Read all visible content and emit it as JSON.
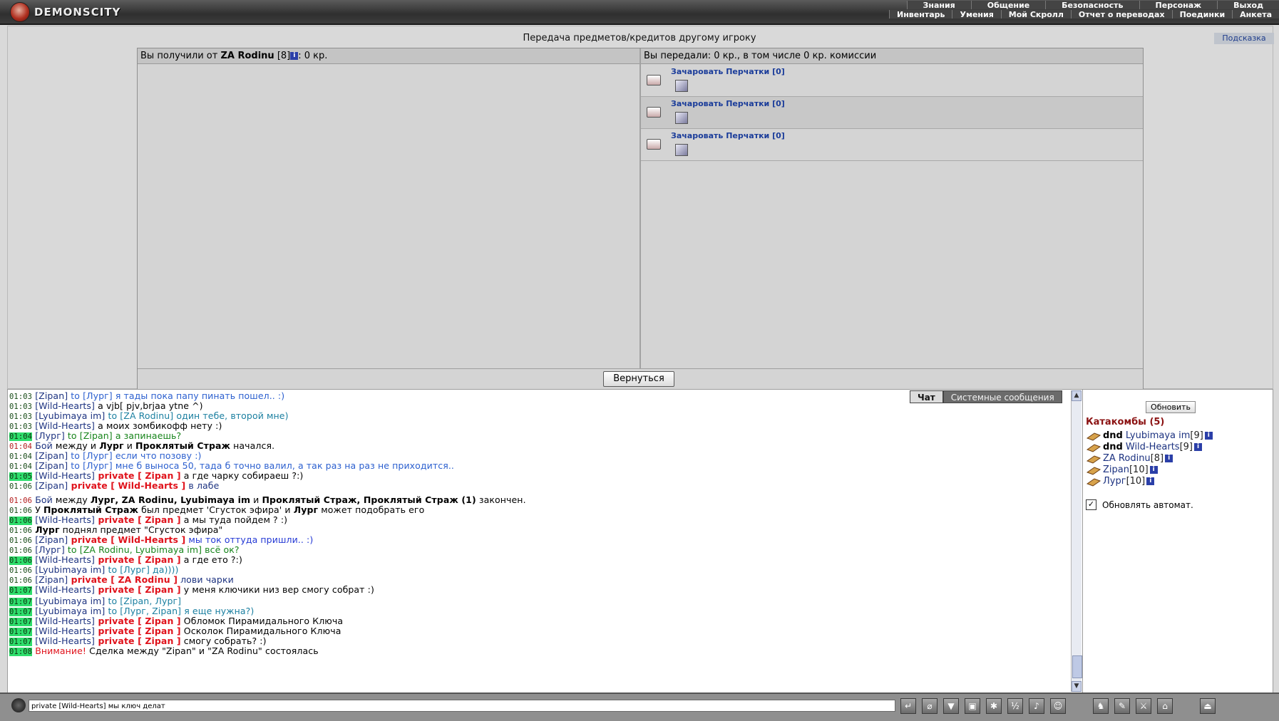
{
  "header": {
    "logo_text": "DEMONSCITY",
    "menu_top": [
      "Знания",
      "Общение",
      "Безопасность",
      "Персонаж",
      "Выход"
    ],
    "menu_bottom": [
      "Инвентарь",
      "Умения",
      "Мой Скролл",
      "Отчет о переводах",
      "Поединки",
      "Анкета"
    ]
  },
  "page": {
    "title": "Передача предметов/кредитов другому игроку",
    "hint_label": "Подсказка"
  },
  "transfer": {
    "received_prefix": "Вы получили от ",
    "received_player": "ZA Rodinu",
    "received_level": "[8]",
    "received_amount": ": 0 кр.",
    "given_text": "Вы передали: 0 кр., в том числе 0 кр. комиссии",
    "items": [
      {
        "name": "Зачаровать Перчатки [0]"
      },
      {
        "name": "Зачаровать Перчатки [0]"
      },
      {
        "name": "Зачаровать Перчатки [0]"
      }
    ],
    "back_label": "Вернуться"
  },
  "chat_tabs": {
    "chat": "Чат",
    "system": "Системные сообщения"
  },
  "chat": [
    {
      "time": "01:03",
      "tsClass": "g",
      "parts": [
        [
          "nm",
          "[Zipan]"
        ],
        [
          "to",
          " to [Лург] я тады пока папу пинать пошел.. :)"
        ]
      ]
    },
    {
      "time": "01:03",
      "tsClass": "g",
      "parts": [
        [
          "nm",
          "[Wild-Hearts]"
        ],
        [
          "sys",
          " а vjb[ pjv,brjaa ytne ^)"
        ]
      ]
    },
    {
      "time": "01:03",
      "tsClass": "g",
      "parts": [
        [
          "nm",
          "[Lyubimaya im]"
        ],
        [
          "tealmsg",
          " to [ZA Rodinu] один тебе, второй мне)"
        ]
      ]
    },
    {
      "time": "01:03",
      "tsClass": "g",
      "parts": [
        [
          "nm",
          "[Wild-Hearts]"
        ],
        [
          "sys",
          " а моих зомбикофф нету :)"
        ]
      ]
    },
    {
      "time": "01:04",
      "tsClass": "hl",
      "parts": [
        [
          "nm",
          "[Лург]"
        ],
        [
          "greenmsg",
          " to [Zipan] а запинаешь?"
        ]
      ]
    },
    {
      "time": "01:04",
      "tsClass": "r",
      "parts": [
        [
          "nm",
          "Бой"
        ],
        [
          "sys",
          " между и "
        ],
        [
          "b",
          "Лург"
        ],
        [
          "sys",
          " и "
        ],
        [
          "b",
          "Проклятый Страж"
        ],
        [
          "sys",
          " начался."
        ]
      ]
    },
    {
      "time": "01:04",
      "tsClass": "g",
      "parts": [
        [
          "nm",
          "[Zipan]"
        ],
        [
          "to",
          " to [Лург] если что позову :)"
        ]
      ]
    },
    {
      "time": "01:04",
      "tsClass": "g",
      "parts": [
        [
          "nm",
          "[Zipan]"
        ],
        [
          "to",
          " to [Лург] мне б выноса 50, тада б точно валил, а так раз на раз не приходится.."
        ]
      ]
    },
    {
      "time": "01:05",
      "tsClass": "hl",
      "parts": [
        [
          "nm",
          "[Wild-Hearts]"
        ],
        [
          "priv",
          " private [ Zipan ]"
        ],
        [
          "sys",
          " а где чарку собираеш ?:)"
        ]
      ]
    },
    {
      "time": "01:06",
      "tsClass": "g",
      "parts": [
        [
          "nm",
          "[Zipan]"
        ],
        [
          "priv",
          " private [ Wild-Hearts ]"
        ],
        [
          "nm",
          " в лабе"
        ]
      ]
    },
    {
      "time": "01:06",
      "tsClass": "r",
      "parts": [
        [
          "nm",
          "Бой"
        ],
        [
          "sys",
          " между "
        ],
        [
          "b",
          "Лург, ZA Rodinu, Lyubimaya im"
        ],
        [
          "sys",
          " и "
        ],
        [
          "b",
          "Проклятый Страж, Проклятый Страж (1)"
        ],
        [
          "sys",
          " закончен."
        ]
      ]
    },
    {
      "time": "01:06",
      "tsClass": "g",
      "parts": [
        [
          "sys",
          "У "
        ],
        [
          "b",
          "Проклятый Страж"
        ],
        [
          "sys",
          " был предмет 'Сгусток эфира' и "
        ],
        [
          "b",
          "Лург"
        ],
        [
          "sys",
          " может подобрать его"
        ]
      ]
    },
    {
      "time": "01:06",
      "tsClass": "hl",
      "parts": [
        [
          "nm",
          "[Wild-Hearts]"
        ],
        [
          "priv",
          " private [ Zipan ]"
        ],
        [
          "sys",
          " а мы туда пойдем ? :)"
        ]
      ]
    },
    {
      "time": "01:06",
      "tsClass": "g",
      "parts": [
        [
          "b",
          "Лург"
        ],
        [
          "sys",
          " поднял предмет \"Сгусток эфира\""
        ]
      ]
    },
    {
      "time": "01:06",
      "tsClass": "g",
      "parts": [
        [
          "nm",
          "[Zipan]"
        ],
        [
          "priv",
          " private [ Wild-Hearts ]"
        ],
        [
          "bluemsg",
          " мы ток оттуда пришли.. :)"
        ]
      ]
    },
    {
      "time": "01:06",
      "tsClass": "g",
      "parts": [
        [
          "nm",
          "[Лург]"
        ],
        [
          "greenmsg",
          " to [ZA Rodinu, Lyubimaya im] всё ок?"
        ]
      ]
    },
    {
      "time": "01:06",
      "tsClass": "hl",
      "parts": [
        [
          "nm",
          "[Wild-Hearts]"
        ],
        [
          "priv",
          " private [ Zipan ]"
        ],
        [
          "sys",
          " а где ето ?:)"
        ]
      ]
    },
    {
      "time": "01:06",
      "tsClass": "g",
      "parts": [
        [
          "nm",
          "[Lyubimaya im]"
        ],
        [
          "tealmsg",
          " to [Лург] да))))"
        ]
      ]
    },
    {
      "time": "01:06",
      "tsClass": "g",
      "parts": [
        [
          "nm",
          "[Zipan]"
        ],
        [
          "priv",
          " private [ ZA Rodinu ]"
        ],
        [
          "nm",
          " лови чарки"
        ]
      ]
    },
    {
      "time": "01:07",
      "tsClass": "hl",
      "parts": [
        [
          "nm",
          "[Wild-Hearts]"
        ],
        [
          "priv",
          " private [ Zipan ]"
        ],
        [
          "sys",
          " у меня ключики низ вер смогу собрат :)"
        ]
      ]
    },
    {
      "time": "01:07",
      "tsClass": "hl",
      "parts": [
        [
          "nm",
          "[Lyubimaya im]"
        ],
        [
          "tealmsg",
          " to [Zipan, Лург]"
        ]
      ]
    },
    {
      "time": "01:07",
      "tsClass": "hl",
      "parts": [
        [
          "nm",
          "[Lyubimaya im]"
        ],
        [
          "tealmsg",
          " to [Лург, Zipan] я еще нужна?)"
        ]
      ]
    },
    {
      "time": "01:07",
      "tsClass": "hl",
      "parts": [
        [
          "nm",
          "[Wild-Hearts]"
        ],
        [
          "priv",
          " private [ Zipan ]"
        ],
        [
          "sys",
          " Обломок Пирамидального Ключа"
        ]
      ]
    },
    {
      "time": "01:07",
      "tsClass": "hl",
      "parts": [
        [
          "nm",
          "[Wild-Hearts]"
        ],
        [
          "priv",
          " private [ Zipan ]"
        ],
        [
          "sys",
          " Осколок Пирамидального Ключа"
        ]
      ]
    },
    {
      "time": "01:07",
      "tsClass": "hl",
      "parts": [
        [
          "nm",
          "[Wild-Hearts]"
        ],
        [
          "priv",
          " private [ Zipan ]"
        ],
        [
          "sys",
          " смогу собрать? :)"
        ]
      ]
    },
    {
      "time": "01:08",
      "tsClass": "hl",
      "parts": [
        [
          "warn",
          "Внимание!"
        ],
        [
          "sys",
          " Сделка между \"Zipan\" и \"ZA Rodinu\" состоялась"
        ]
      ]
    }
  ],
  "sidebar": {
    "refresh_label": "Обновить",
    "location": "Катакомбы (5)",
    "players": [
      {
        "status": "dnd",
        "name": "Lyubimaya im",
        "level": "[9]"
      },
      {
        "status": "dnd",
        "name": "Wild-Hearts",
        "level": "[9]"
      },
      {
        "status": "",
        "name": "ZA Rodinu",
        "level": "[8]"
      },
      {
        "status": "",
        "name": "Zipan",
        "level": "[10]"
      },
      {
        "status": "",
        "name": "Лург",
        "level": "[10]"
      }
    ],
    "auto_refresh_label": "Обновлять автомат."
  },
  "input": {
    "value": "private [Wild-Hearts] мы ключ делат"
  },
  "colors": {
    "accent_blue": "#1c3280",
    "private_red": "#e0121b",
    "time_highlight": "#2ede6c"
  }
}
